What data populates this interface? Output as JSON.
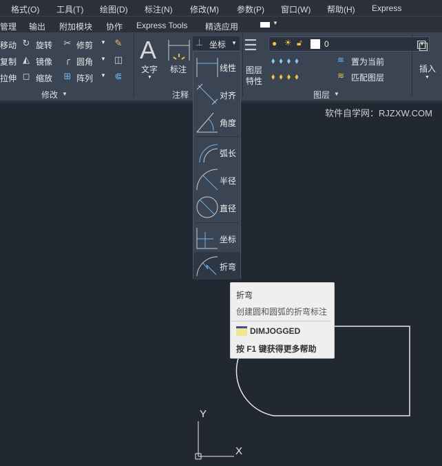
{
  "menu": [
    "格式(O)",
    "工具(T)",
    "绘图(D)",
    "标注(N)",
    "修改(M)",
    "参数(P)",
    "窗口(W)",
    "帮助(H)",
    "Express"
  ],
  "tabs": [
    "管理",
    "输出",
    "附加模块",
    "协作",
    "Express Tools",
    "精选应用"
  ],
  "modify_panel": {
    "items": [
      "移动",
      "旋转",
      "修剪",
      "复制",
      "镜像",
      "圆角",
      "拉伸",
      "缩放",
      "阵列"
    ],
    "title": "修改"
  },
  "annotation_panel": {
    "text": "文字",
    "dim": "标注",
    "dim_dropdown": "坐标",
    "title": "注释"
  },
  "layers_panel": {
    "layer_props": [
      "图层",
      "特性"
    ],
    "layer_value": "0",
    "set_current": "置为当前",
    "match_layer": "匹配图层",
    "title": "图层"
  },
  "insert": "插入",
  "dim_menu": [
    "线性",
    "对齐",
    "角度",
    "弧长",
    "半径",
    "直径",
    "坐标",
    "折弯"
  ],
  "watermark": "软件自学网：RJZXW.COM",
  "tooltip": {
    "title": "折弯",
    "desc": "创建圆和圆弧的折弯标注",
    "command": "DIMJOGGED",
    "help": "按 F1 键获得更多帮助"
  },
  "ucs": {
    "x": "X",
    "y": "Y"
  }
}
